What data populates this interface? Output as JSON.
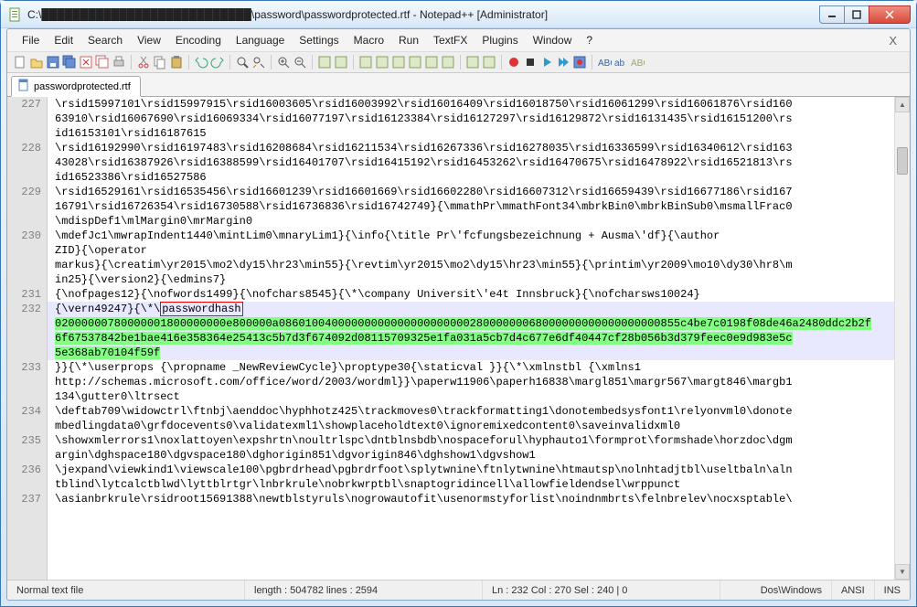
{
  "window": {
    "title": "C:\\███████████████████████████\\password\\passwordprotected.rtf - Notepad++ [Administrator]"
  },
  "menu": {
    "items": [
      "File",
      "Edit",
      "Search",
      "View",
      "Encoding",
      "Language",
      "Settings",
      "Macro",
      "Run",
      "TextFX",
      "Plugins",
      "Window",
      "?"
    ]
  },
  "tab": {
    "label": "passwordprotected.rtf"
  },
  "toolbar_icons": [
    "new-file",
    "open-file",
    "save",
    "save-all",
    "close",
    "close-all",
    "print",
    "sep",
    "cut",
    "copy",
    "paste",
    "sep",
    "undo",
    "redo",
    "sep",
    "find",
    "replace",
    "sep",
    "zoom-in",
    "zoom-out",
    "sep",
    "sync-v",
    "sync-h",
    "sep",
    "word-wrap",
    "show-all",
    "indent-guide",
    "user-lang",
    "doc-map",
    "func-list",
    "sep",
    "folder",
    "monitor",
    "sep",
    "record-macro",
    "stop-macro",
    "play-macro",
    "play-multi",
    "save-macro",
    "sep",
    "spell-check",
    "spell-next",
    "spell-prev"
  ],
  "lines": [
    {
      "n": "227",
      "cls": "",
      "t": "\\rsid15997101\\rsid15997915\\rsid16003605\\rsid16003992\\rsid16016409\\rsid16018750\\rsid16061299\\rsid16061876\\rsid160"
    },
    {
      "n": "",
      "cls": "",
      "t": "63910\\rsid16067690\\rsid16069334\\rsid16077197\\rsid16123384\\rsid16127297\\rsid16129872\\rsid16131435\\rsid16151200\\rs"
    },
    {
      "n": "",
      "cls": "",
      "t": "id16153101\\rsid16187615"
    },
    {
      "n": "228",
      "cls": "",
      "t": "\\rsid16192990\\rsid16197483\\rsid16208684\\rsid16211534\\rsid16267336\\rsid16278035\\rsid16336599\\rsid16340612\\rsid163"
    },
    {
      "n": "",
      "cls": "",
      "t": "43028\\rsid16387926\\rsid16388599\\rsid16401707\\rsid16415192\\rsid16453262\\rsid16470675\\rsid16478922\\rsid16521813\\rs"
    },
    {
      "n": "",
      "cls": "",
      "t": "id16523386\\rsid16527586"
    },
    {
      "n": "229",
      "cls": "",
      "t": "\\rsid16529161\\rsid16535456\\rsid16601239\\rsid16601669\\rsid16602280\\rsid16607312\\rsid16659439\\rsid16677186\\rsid167"
    },
    {
      "n": "",
      "cls": "",
      "t": "16791\\rsid16726354\\rsid16730588\\rsid16736836\\rsid16742749}{\\mmathPr\\mmathFont34\\mbrkBin0\\mbrkBinSub0\\msmallFrac0"
    },
    {
      "n": "",
      "cls": "",
      "t": "\\mdispDef1\\mlMargin0\\mrMargin0"
    },
    {
      "n": "230",
      "cls": "",
      "t": "\\mdefJc1\\mwrapIndent1440\\mintLim0\\mnaryLim1}{\\info{\\title Pr\\'fcfungsbezeichnung + Ausma\\'df}{\\author "
    },
    {
      "n": "",
      "cls": "",
      "t": "ZID}{\\operator "
    },
    {
      "n": "",
      "cls": "",
      "t": "markus}{\\creatim\\yr2015\\mo2\\dy15\\hr23\\min55}{\\revtim\\yr2015\\mo2\\dy15\\hr23\\min55}{\\printim\\yr2009\\mo10\\dy30\\hr8\\m"
    },
    {
      "n": "",
      "cls": "",
      "t": "in25}{\\version2}{\\edmins7}"
    },
    {
      "n": "231",
      "cls": "",
      "t": "{\\nofpages12}{\\nofwords1499}{\\nofchars8545}{\\*\\company Universit\\'e4t Innsbruck}{\\nofcharsws10024}"
    },
    {
      "n": "232",
      "cls": "sel",
      "t": ""
    },
    {
      "n": "",
      "cls": "sel",
      "t": ""
    },
    {
      "n": "",
      "cls": "sel",
      "t": ""
    },
    {
      "n": "",
      "cls": "sel",
      "t": ""
    },
    {
      "n": "233",
      "cls": "",
      "t": "}}{\\*\\userprops {\\propname _NewReviewCycle}\\proptype30{\\staticval }}{\\*\\xmlnstbl {\\xmlns1 "
    },
    {
      "n": "",
      "cls": "",
      "t": "http://schemas.microsoft.com/office/word/2003/wordml}}\\paperw11906\\paperh16838\\margl851\\margr567\\margt846\\margb1"
    },
    {
      "n": "",
      "cls": "",
      "t": "134\\gutter0\\ltrsect"
    },
    {
      "n": "234",
      "cls": "",
      "t": "\\deftab709\\widowctrl\\ftnbj\\aenddoc\\hyphhotz425\\trackmoves0\\trackformatting1\\donotembedsysfont1\\relyonvml0\\donote"
    },
    {
      "n": "",
      "cls": "",
      "t": "mbedlingdata0\\grfdocevents0\\validatexml1\\showplaceholdtext0\\ignoremixedcontent0\\saveinvalidxml0"
    },
    {
      "n": "235",
      "cls": "",
      "t": "\\showxmlerrors1\\noxlattoyen\\expshrtn\\noultrlspc\\dntblnsbdb\\nospaceforul\\hyphauto1\\formprot\\formshade\\horzdoc\\dgm"
    },
    {
      "n": "",
      "cls": "",
      "t": "argin\\dghspace180\\dgvspace180\\dghorigin851\\dgvorigin846\\dghshow1\\dgvshow1"
    },
    {
      "n": "236",
      "cls": "",
      "t": "\\jexpand\\viewkind1\\viewscale100\\pgbrdrhead\\pgbrdrfoot\\splytwnine\\ftnlytwnine\\htmautsp\\nolnhtadjtbl\\useltbaln\\aln"
    },
    {
      "n": "",
      "cls": "",
      "t": "tblind\\lytcalctblwd\\lyttblrtgr\\lnbrkrule\\nobrkwrptbl\\snaptogridincell\\allowfieldendsel\\wrppunct"
    },
    {
      "n": "237",
      "cls": "",
      "t": "\\asianbrkrule\\rsidroot15691388\\newtblstyruls\\nogrowautofit\\usenormstyforlist\\noindnmbrts\\felnbrelev\\nocxsptable\\"
    }
  ],
  "sel_line": {
    "prefix": "{\\vern49247}{\\*\\",
    "boxed": "passwordhash",
    "g1": "02000000780000001800000000e800000a0860100400000000000000000000028000000068000000000000000000855c4be7c0198f08de46a2480ddc2b2f",
    "g2": "6f67537842be1bae416e358364e25413c5b7d3f674092d08115709325e1fa031a5cb7d4c677e6df40447cf28b056b3d379feec0e9d983e5c",
    "g3": "5e368ab70104f59f"
  },
  "status": {
    "type": "Normal text file",
    "len": "length : 504782    lines : 2594",
    "pos": "Ln : 232    Col : 270    Sel : 240 | 0",
    "eol": "Dos\\Windows",
    "enc": "ANSI",
    "ins": "INS"
  }
}
